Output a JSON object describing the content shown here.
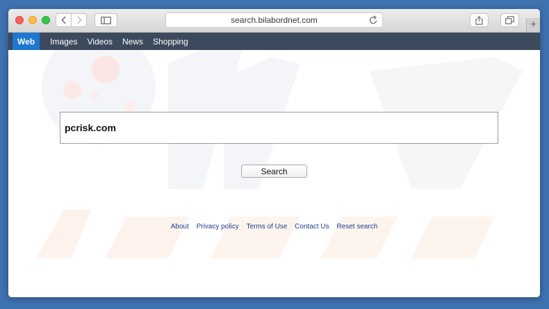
{
  "browser": {
    "address_url": "search.bilabordnet.com",
    "new_tab_label": "+"
  },
  "nav": {
    "items": [
      {
        "label": "Web",
        "active": true
      },
      {
        "label": "Images",
        "active": false
      },
      {
        "label": "Videos",
        "active": false
      },
      {
        "label": "News",
        "active": false
      },
      {
        "label": "Shopping",
        "active": false
      }
    ]
  },
  "search": {
    "value": "pcrisk.com",
    "button_label": "Search"
  },
  "footer": {
    "links": [
      "About",
      "Privacy policy",
      "Terms of Use",
      "Contact Us",
      "Reset search"
    ]
  },
  "colors": {
    "desktop": "#3f72b0",
    "navbar": "#3b4a5c",
    "active_tab": "#1e77d1",
    "footer_link": "#1b3f8f"
  }
}
